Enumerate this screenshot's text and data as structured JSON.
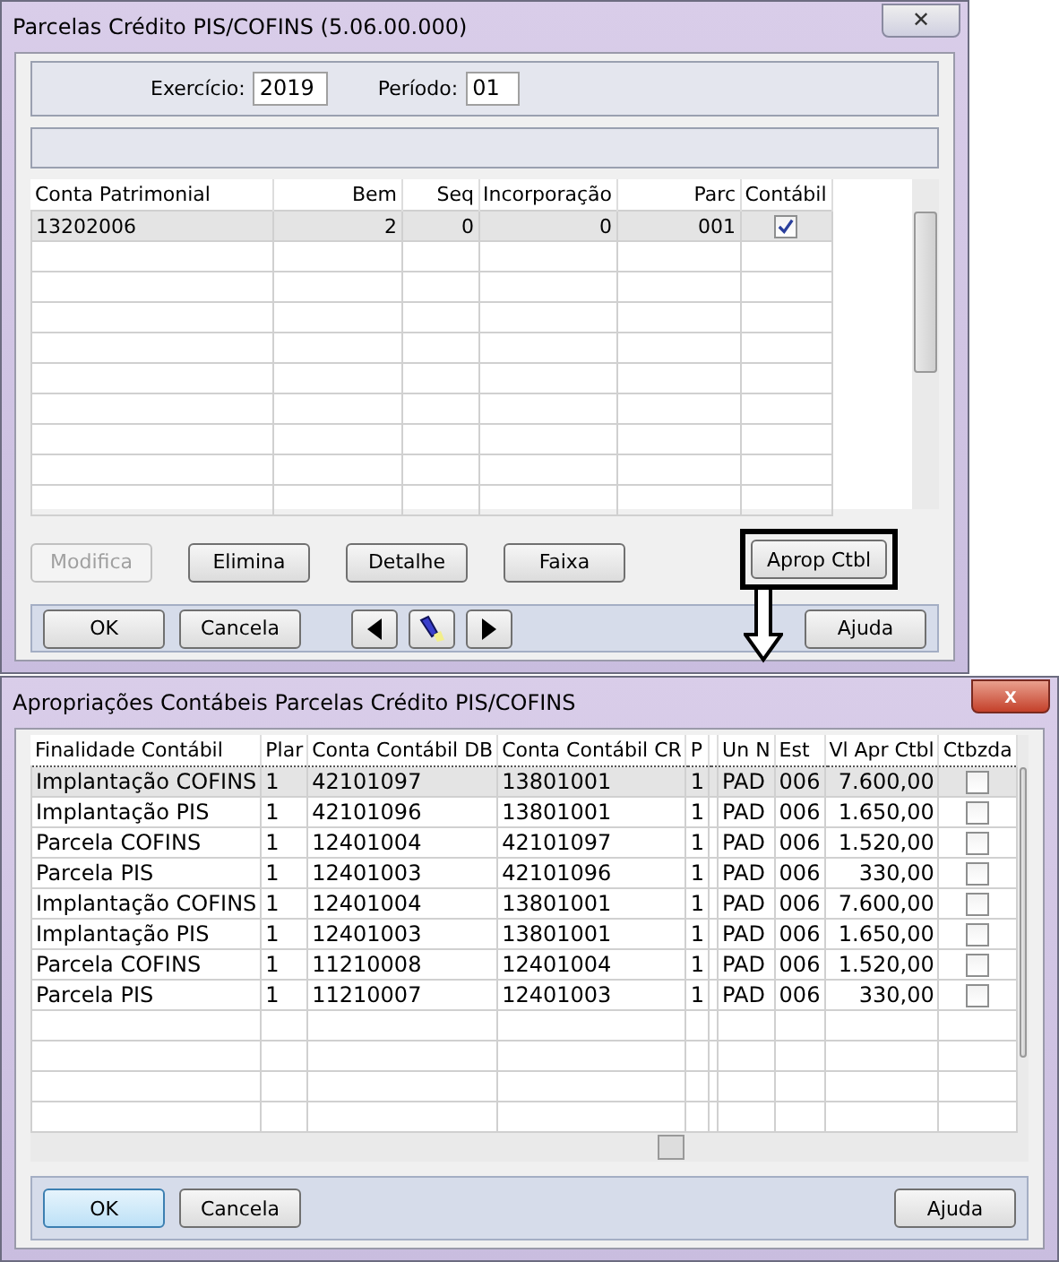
{
  "top_window": {
    "title": "Parcelas Crédito PIS/COFINS (5.06.00.000)",
    "close": "✕",
    "fields": [
      {
        "label": "Exercício:",
        "value": "2019"
      },
      {
        "label": "Período:",
        "value": "01"
      }
    ],
    "table": {
      "columns": [
        "Conta Patrimonial",
        "Bem",
        "Seq",
        "Incorporação",
        "Parc",
        "Contábil"
      ],
      "rows": [
        {
          "cells": [
            "13202006",
            "2",
            "0",
            "0",
            "001"
          ],
          "checked": true,
          "selected": true
        }
      ]
    },
    "actions": [
      {
        "label": "Modifica",
        "disabled": true,
        "highlighted": false
      },
      {
        "label": "Elimina",
        "disabled": false,
        "highlighted": false
      },
      {
        "label": "Detalhe",
        "disabled": false,
        "highlighted": false
      },
      {
        "label": "Faixa",
        "disabled": false,
        "highlighted": false
      },
      {
        "label": "Aprop Ctbl",
        "disabled": false,
        "highlighted": true
      }
    ],
    "footer": {
      "ok": "OK",
      "cancel": "Cancela",
      "help": "Ajuda"
    }
  },
  "bottom_window": {
    "title": "Apropriações Contábeis Parcelas Crédito PIS/COFINS",
    "close": "x",
    "table": {
      "columns": [
        "Finalidade Contábil",
        "Plar",
        "Conta Contábil DB",
        "Conta Contábil CR",
        "P",
        "",
        "Un N",
        "Est",
        "Vl Apr Ctbl",
        "Ctbzda"
      ],
      "rows": [
        {
          "cells": [
            "Implantação COFINS",
            "1",
            "42101097",
            "13801001",
            "1",
            "",
            "PAD",
            "006",
            "7.600,00"
          ],
          "checked": false,
          "selected": true
        },
        {
          "cells": [
            "Implantação PIS",
            "1",
            "42101096",
            "13801001",
            "1",
            "",
            "PAD",
            "006",
            "1.650,00"
          ],
          "checked": false,
          "selected": false
        },
        {
          "cells": [
            "Parcela COFINS",
            "1",
            "12401004",
            "42101097",
            "1",
            "",
            "PAD",
            "006",
            "1.520,00"
          ],
          "checked": false,
          "selected": false
        },
        {
          "cells": [
            "Parcela PIS",
            "1",
            "12401003",
            "42101096",
            "1",
            "",
            "PAD",
            "006",
            "330,00"
          ],
          "checked": false,
          "selected": false
        },
        {
          "cells": [
            "Implantação COFINS",
            "1",
            "12401004",
            "13801001",
            "1",
            "",
            "PAD",
            "006",
            "7.600,00"
          ],
          "checked": false,
          "selected": false
        },
        {
          "cells": [
            "Implantação PIS",
            "1",
            "12401003",
            "13801001",
            "1",
            "",
            "PAD",
            "006",
            "1.650,00"
          ],
          "checked": false,
          "selected": false
        },
        {
          "cells": [
            "Parcela COFINS",
            "1",
            "11210008",
            "12401004",
            "1",
            "",
            "PAD",
            "006",
            "1.520,00"
          ],
          "checked": false,
          "selected": false
        },
        {
          "cells": [
            "Parcela PIS",
            "1",
            "11210007",
            "12401003",
            "1",
            "",
            "PAD",
            "006",
            "330,00"
          ],
          "checked": false,
          "selected": false
        }
      ]
    },
    "footer": {
      "ok": "OK",
      "cancel": "Cancela",
      "help": "Ajuda"
    }
  }
}
